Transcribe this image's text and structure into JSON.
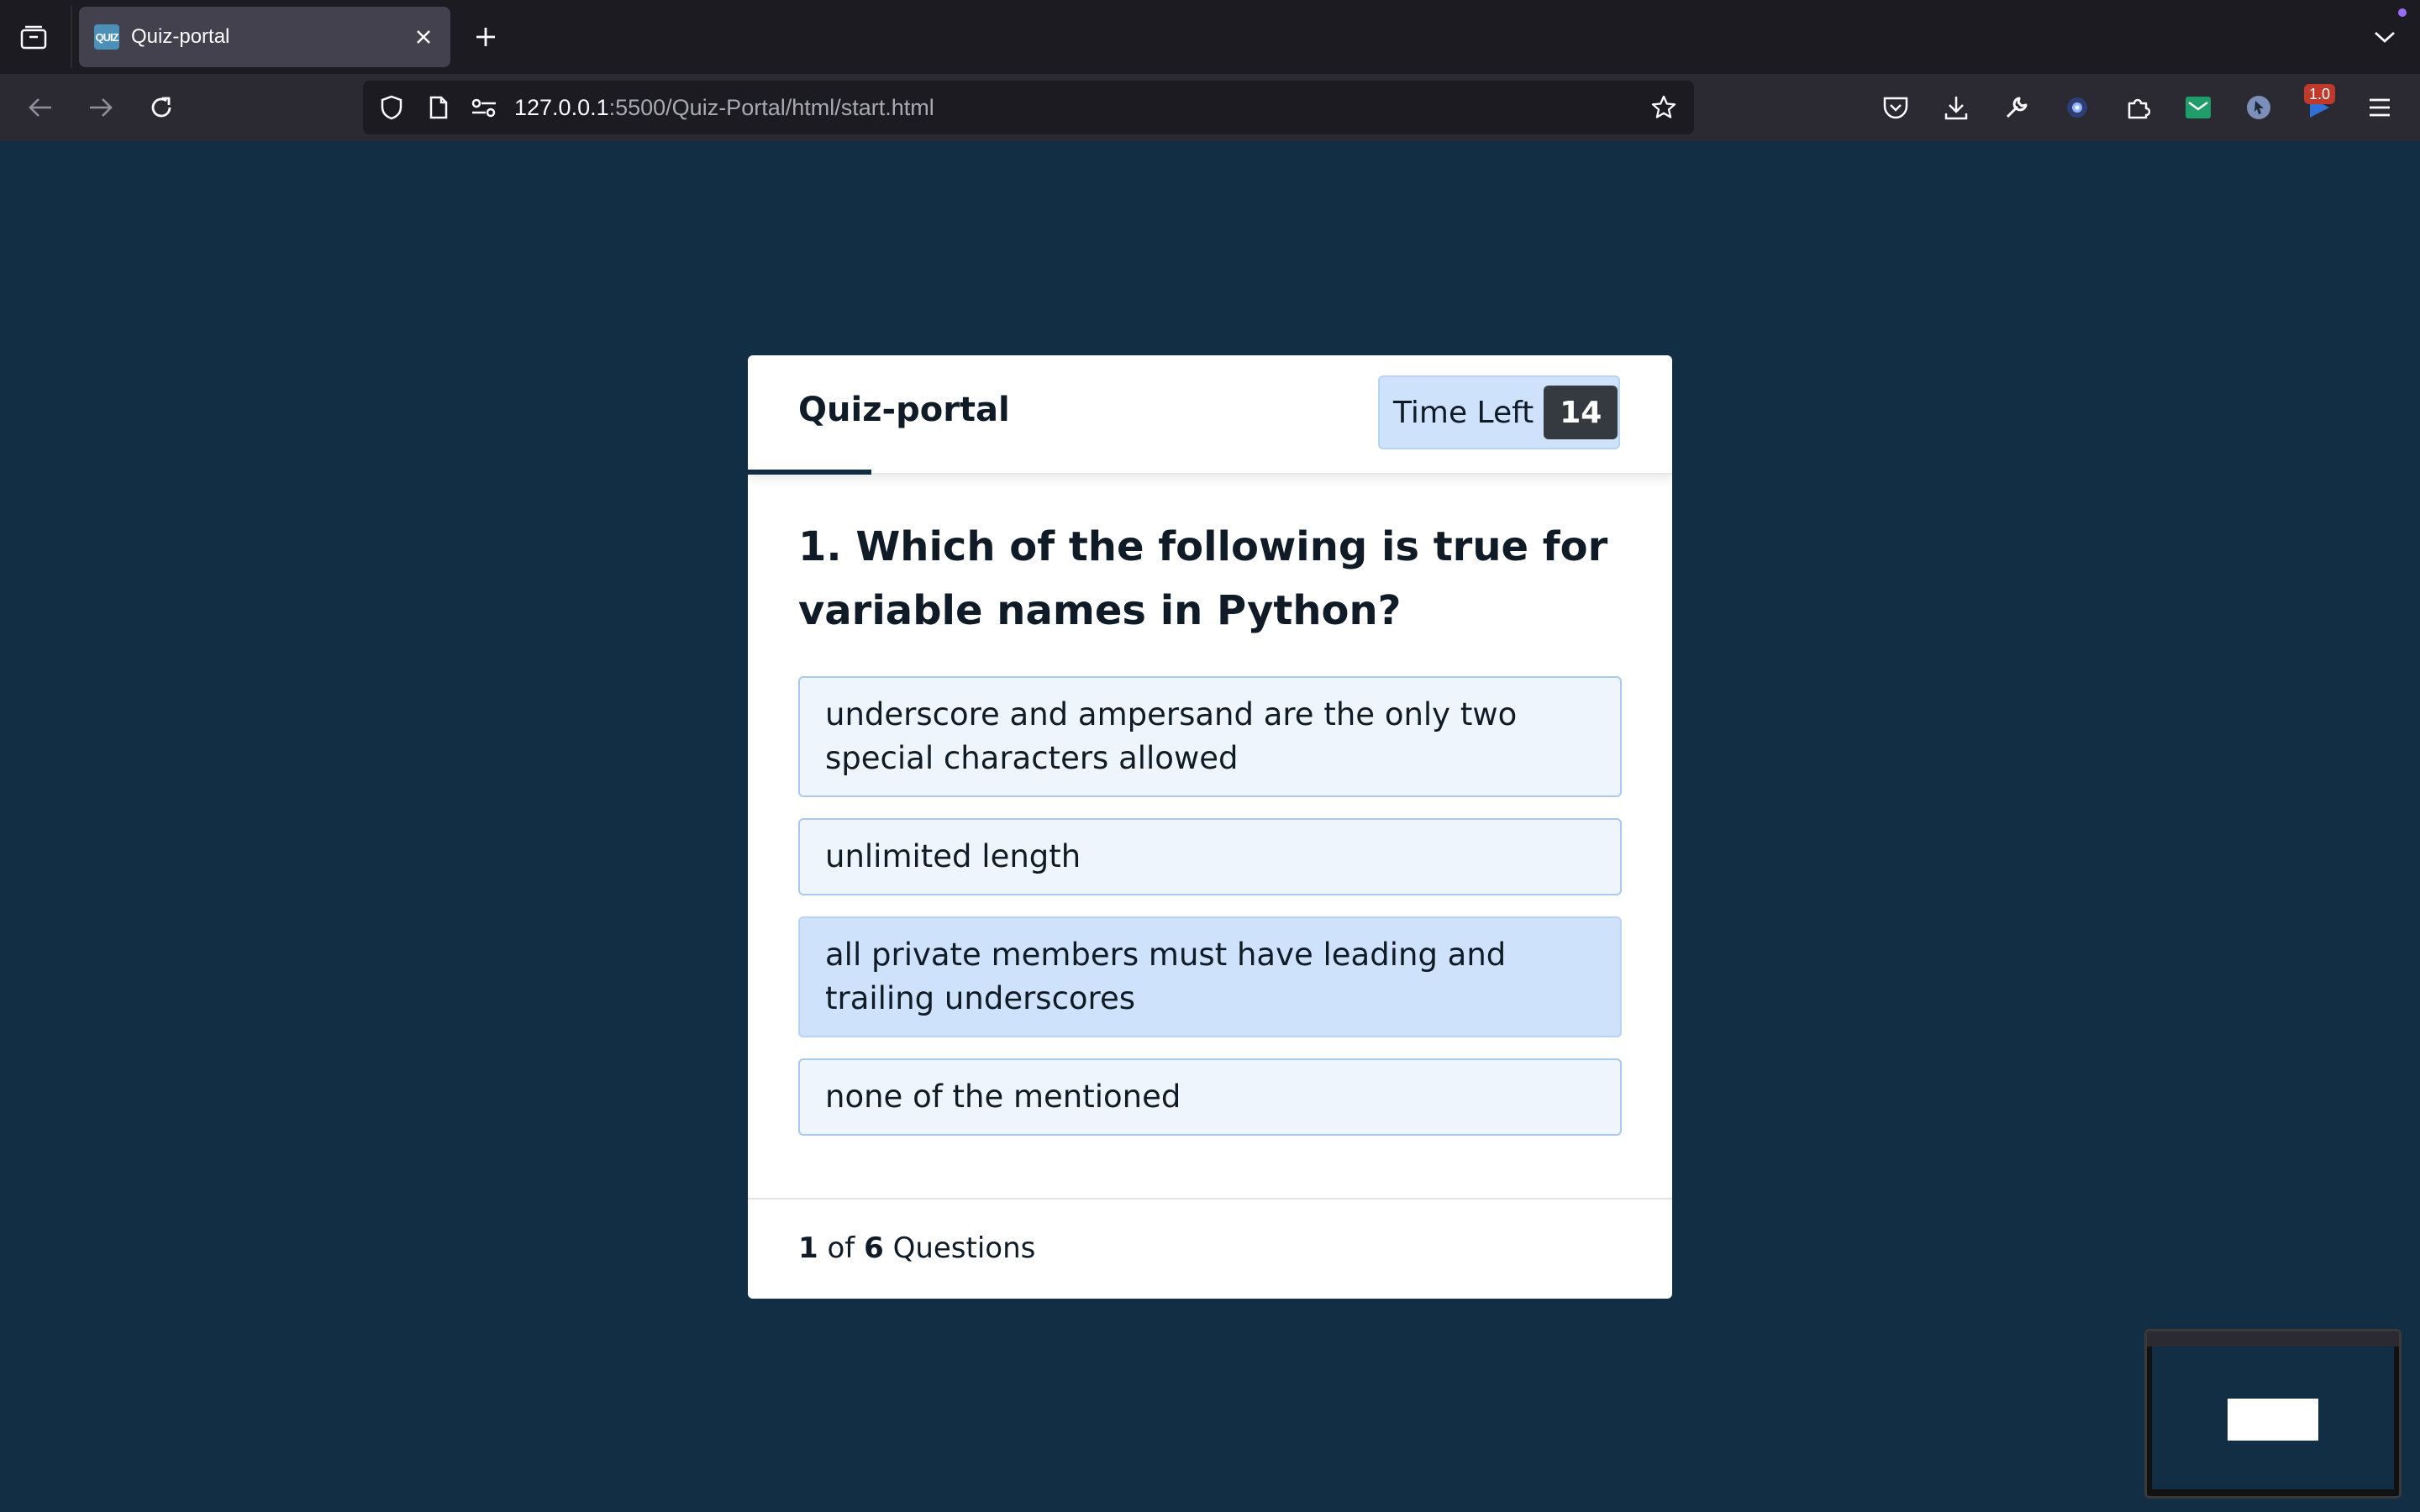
{
  "browser": {
    "tab": {
      "title": "Quiz-portal",
      "favicon": "QUIZ"
    },
    "url": {
      "host": "127.0.0.1",
      "rest": ":5500/Quiz-Portal/html/start.html"
    },
    "badge": "1.0",
    "icons": [
      "tab-list-icon",
      "close-icon",
      "plus-icon",
      "chevron-down-icon",
      "back-arrow-icon",
      "forward-arrow-icon",
      "reload-icon",
      "shield-icon",
      "page-icon",
      "permissions-icon",
      "star-icon",
      "pocket-icon",
      "download-icon",
      "wrench-icon",
      "extension-icon",
      "puzzle-icon",
      "mail-icon",
      "cursor-icon",
      "play-icon",
      "menu-icon"
    ]
  },
  "quiz": {
    "brand": "Quiz-portal",
    "timer_label": "Time Left",
    "timer_value": "14",
    "progress": 0.1333,
    "question": "1. Which of the following is true for variable names in Python?",
    "options": [
      "underscore and ampersand are the only two special characters allowed",
      "unlimited length",
      "all private members must have leading and trailing underscores",
      "none of the mentioned"
    ],
    "selected_index": 2,
    "footer": {
      "current": "1",
      "of": "of",
      "total": "6",
      "suffix": "Questions"
    }
  },
  "colors": {
    "page_bg": "#122e45",
    "accent": "#0f2e45",
    "option_bg": "#eef5fd",
    "option_border": "#a9c9ef",
    "option_selected_bg": "#cfe2fb",
    "timer_badge_bg": "#343a40"
  }
}
